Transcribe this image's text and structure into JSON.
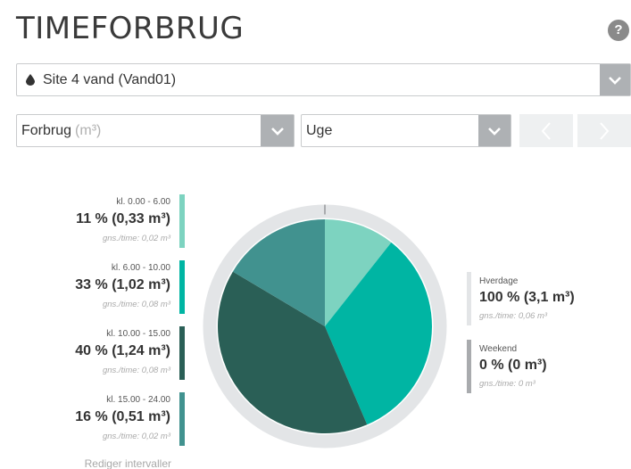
{
  "header": {
    "title": "TIMEFORBRUG",
    "help": "?"
  },
  "site_select": {
    "value": "Site 4 vand (Vand01)",
    "icon": "water-drop-icon"
  },
  "measure_select": {
    "value": "Forbrug",
    "unit": "(m³)"
  },
  "period_select": {
    "value": "Uge"
  },
  "intervals": [
    {
      "label": "kl. 0.00 - 6.00",
      "value": "11 % (0,33 m³)",
      "avg": "gns./time: 0,02 m³",
      "color": "#7dd3c0"
    },
    {
      "label": "kl. 6.00 - 10.00",
      "value": "33 % (1,02 m³)",
      "avg": "gns./time: 0,08 m³",
      "color": "#00b5a3"
    },
    {
      "label": "kl. 10.00 - 15.00",
      "value": "40 % (1,24 m³)",
      "avg": "gns./time: 0,08 m³",
      "color": "#2a5f56"
    },
    {
      "label": "kl. 15.00 - 24.00",
      "value": "16 % (0,51 m³)",
      "avg": "gns./time: 0,02 m³",
      "color": "#41928f"
    }
  ],
  "edit_intervals": "Rediger intervaller",
  "day_types": [
    {
      "label": "Hverdage",
      "value": "100 % (3,1 m³)",
      "avg": "gns./time: 0,06 m³",
      "color": "#e3e5e7"
    },
    {
      "label": "Weekend",
      "value": "0 % (0 m³)",
      "avg": "gns./time: 0 m³",
      "color": "#a9abae"
    }
  ],
  "chart_data": {
    "type": "pie",
    "categories": [
      "kl. 0.00 - 6.00",
      "kl. 6.00 - 10.00",
      "kl. 10.00 - 15.00",
      "kl. 15.00 - 24.00"
    ],
    "values": [
      0.33,
      1.02,
      1.24,
      0.51
    ],
    "percent": [
      11,
      33,
      40,
      16
    ],
    "colors": [
      "#7dd3c0",
      "#00b5a3",
      "#2a5f56",
      "#41928f"
    ],
    "outer_ring": {
      "categories": [
        "Hverdage",
        "Weekend"
      ],
      "values": [
        3.1,
        0
      ],
      "colors": [
        "#e3e5e7",
        "#a9abae"
      ]
    }
  }
}
